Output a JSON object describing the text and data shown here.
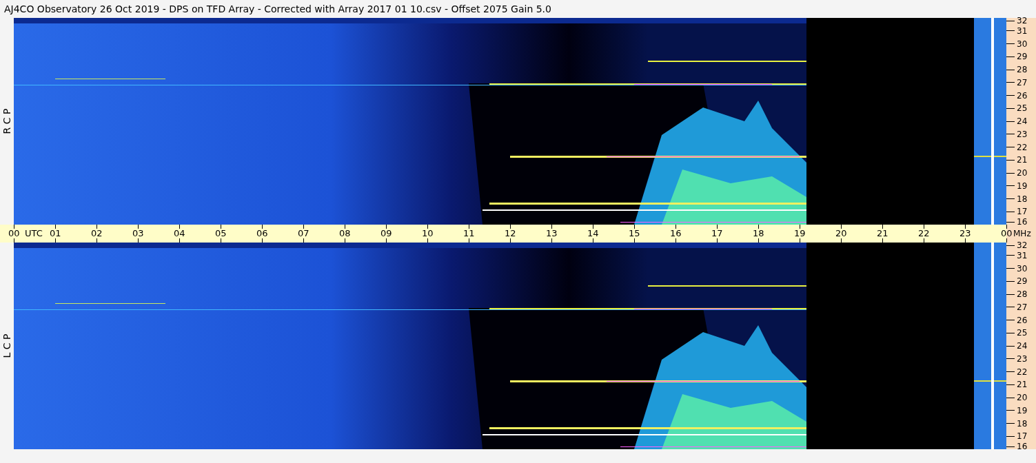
{
  "window": {
    "title": "AJ4CO Observatory  26 Oct 2019  -  DPS on TFD Array  -  Corrected with Array 2017 01 10.csv  -  Offset 2075  Gain 5.0"
  },
  "panels": [
    {
      "label": "R C P",
      "freq_ticks": [
        "32",
        "31",
        "30",
        "29",
        "28",
        "27",
        "26",
        "25",
        "24",
        "23",
        "22",
        "21",
        "20",
        "19",
        "18",
        "17",
        "16"
      ]
    },
    {
      "label": "L C P",
      "freq_ticks": [
        "32",
        "31",
        "30",
        "29",
        "28",
        "27",
        "26",
        "25",
        "24",
        "23",
        "22",
        "21",
        "20",
        "19",
        "18",
        "17",
        "16"
      ]
    }
  ],
  "time_axis": {
    "ticks": [
      "00",
      "01",
      "02",
      "03",
      "04",
      "05",
      "06",
      "07",
      "08",
      "09",
      "10",
      "11",
      "12",
      "13",
      "14",
      "15",
      "16",
      "17",
      "18",
      "19",
      "20",
      "21",
      "22",
      "23",
      "00"
    ],
    "zone": "UTC",
    "freq_unit": "MHz"
  }
}
